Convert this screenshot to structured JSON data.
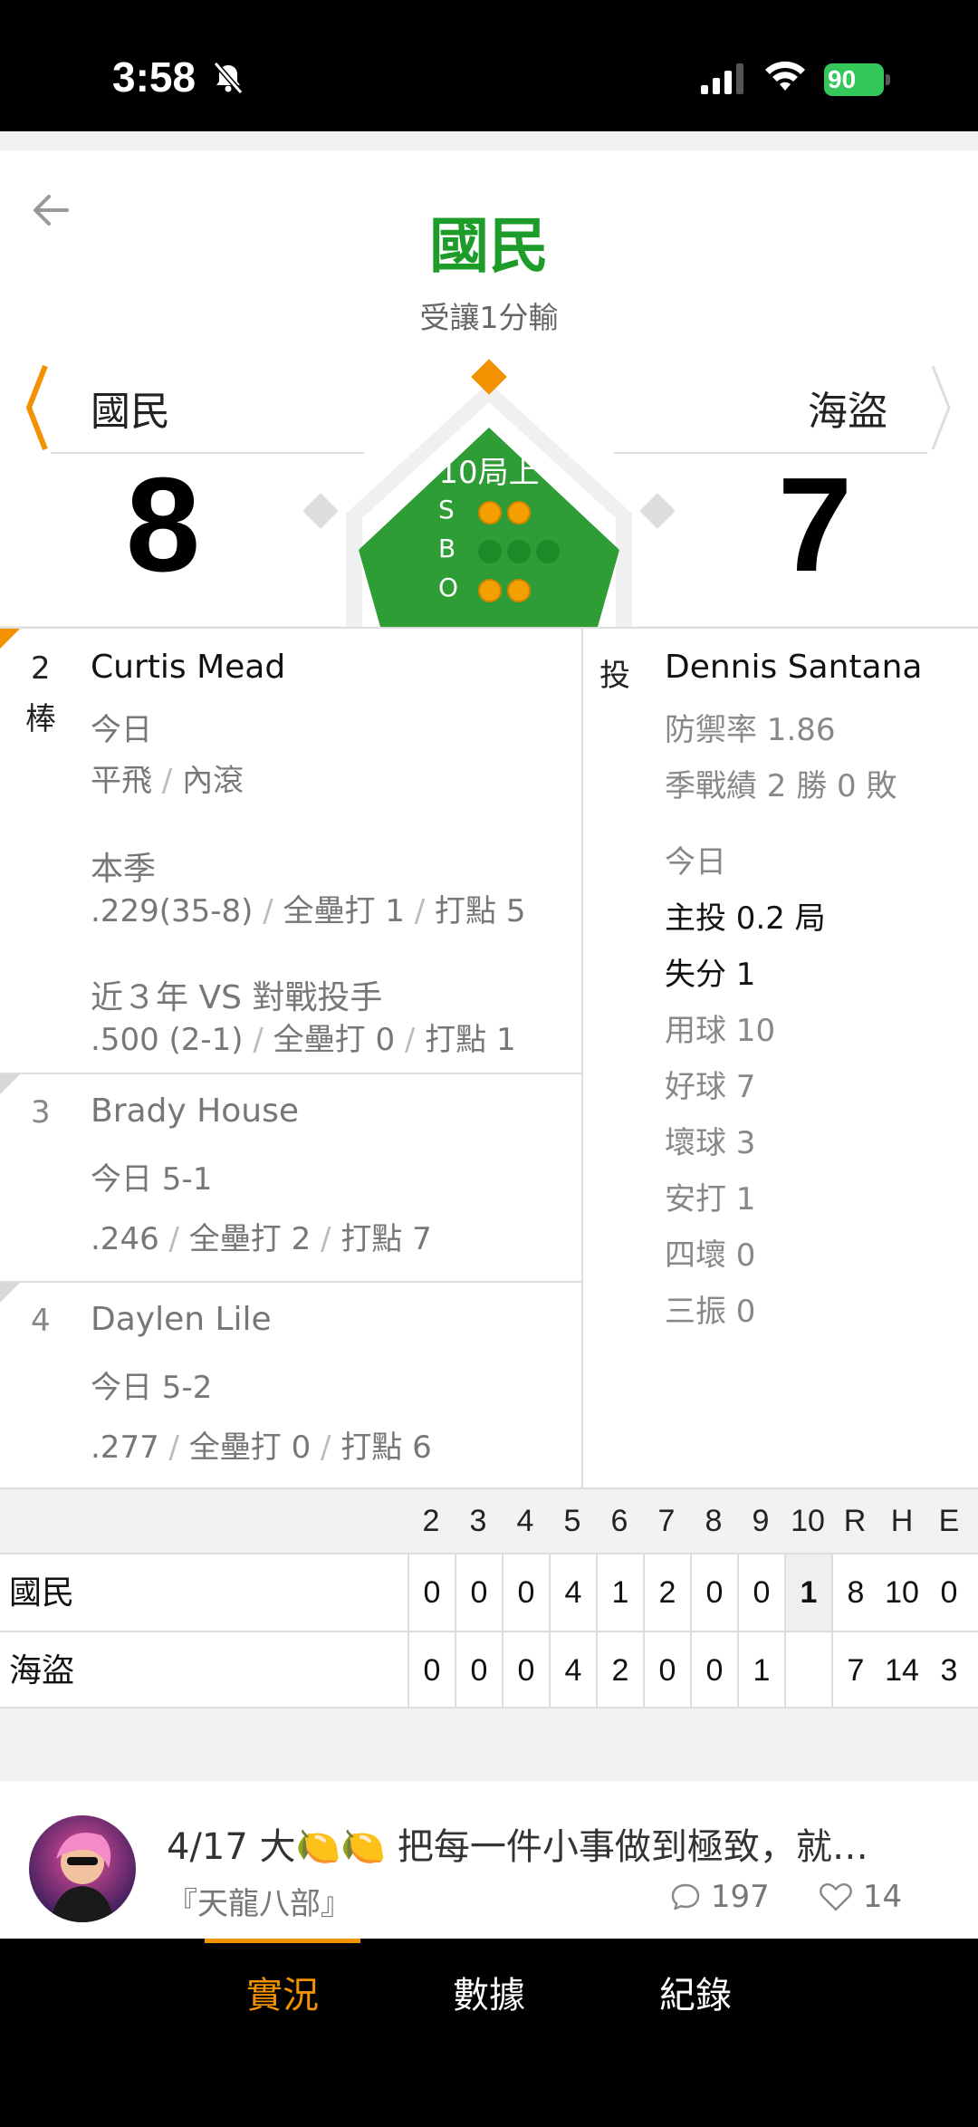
{
  "status_bar": {
    "time": "3:58",
    "battery": "90"
  },
  "header": {
    "winner": "國民",
    "result": "受讓1分輸",
    "away_team": "國民",
    "home_team": "海盜",
    "away_score": "8",
    "home_score": "7",
    "inning": "10局上",
    "count_labels": {
      "s": "S",
      "b": "B",
      "o": "O"
    },
    "strikes": 2,
    "balls": 0,
    "outs": 2
  },
  "batters": [
    {
      "order": "2",
      "order_suffix": "棒",
      "name": "Curtis Mead",
      "today_label": "今日",
      "today_a": "平飛",
      "today_b": "內滾",
      "season_label": "本季",
      "season_avg": ".229(35-8)",
      "season_hr": "全壘打 1",
      "season_rbi": "打點 5",
      "vs_label": "近３年 VS 對戰投手",
      "vs_avg": ".500 (2-1)",
      "vs_hr": "全壘打 0",
      "vs_rbi": "打點 1"
    },
    {
      "order": "3",
      "name": "Brady House",
      "today": "今日 5-1",
      "avg": ".246",
      "hr": "全壘打 2",
      "rbi": "打點 7"
    },
    {
      "order": "4",
      "name": "Daylen Lile",
      "today": "今日 5-2",
      "avg": ".277",
      "hr": "全壘打 0",
      "rbi": "打點 6"
    }
  ],
  "pitcher": {
    "label": "投",
    "name": "Dennis Santana",
    "era": "防禦率 1.86",
    "record": "季戰績 2 勝 0 敗",
    "today_label": "今日",
    "ip": "主投 0.2 局",
    "runs": "失分 1",
    "pitches": "用球 10",
    "strikes": "好球 7",
    "balls": "壞球 3",
    "hits": "安打 1",
    "walks": "四壞 0",
    "strikeouts": "三振 0"
  },
  "linescore": {
    "columns": [
      "2",
      "3",
      "4",
      "5",
      "6",
      "7",
      "8",
      "9",
      "10",
      "R",
      "H",
      "E"
    ],
    "rows": [
      {
        "team": "國民",
        "values": [
          "0",
          "0",
          "0",
          "4",
          "1",
          "2",
          "0",
          "0",
          "1",
          "8",
          "10",
          "0"
        ]
      },
      {
        "team": "海盜",
        "values": [
          "0",
          "0",
          "0",
          "4",
          "2",
          "0",
          "0",
          "1",
          "",
          "7",
          "14",
          "3"
        ]
      }
    ]
  },
  "chat": {
    "message": "4/17 大🍋🍋 把每一件小事做到極致，就…",
    "group": "『天龍八部』",
    "comments": "197",
    "likes": "14"
  },
  "nav": {
    "items": [
      "實況",
      "數據",
      "紀錄"
    ],
    "active": 0
  },
  "colors": {
    "accent": "#f39200",
    "green": "#1e9c2a",
    "field": "#2f9d36"
  }
}
